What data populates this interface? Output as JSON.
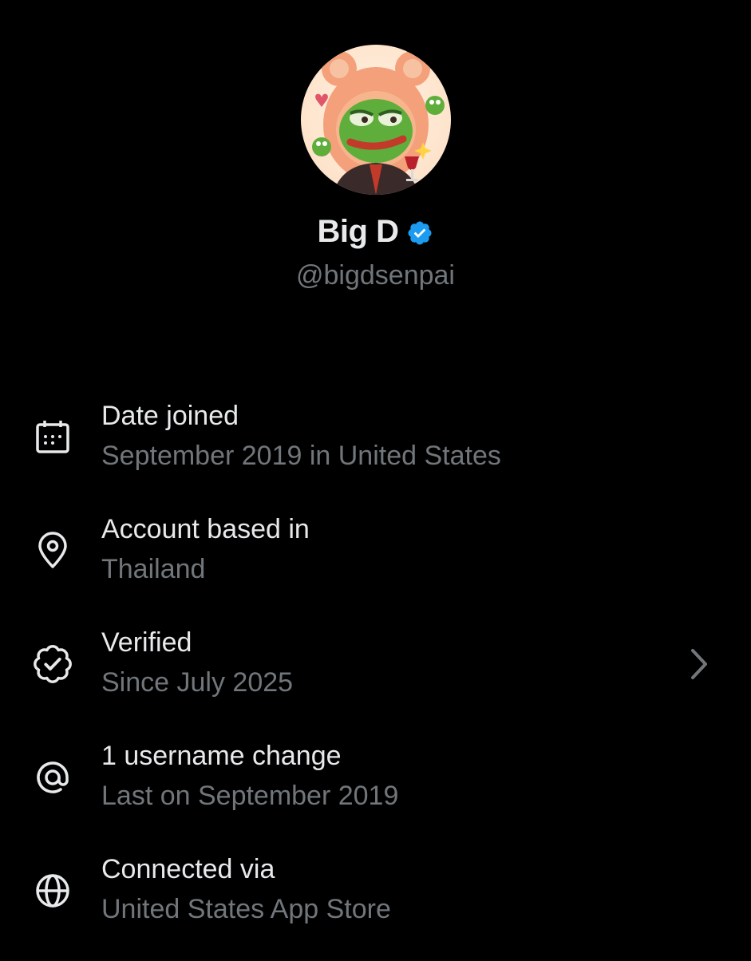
{
  "profile": {
    "display_name": "Big D",
    "handle": "@bigdsenpai",
    "avatar_icon": "cartoon-frog-avatar",
    "verified_badge_icon": "verified-check-badge-icon",
    "verified_color": "#1d9bf0"
  },
  "about": {
    "items": [
      {
        "icon": "calendar-icon",
        "title": "Date joined",
        "subtitle": "September 2019 in United States"
      },
      {
        "icon": "location-pin-icon",
        "title": "Account based in",
        "subtitle": "Thailand"
      },
      {
        "icon": "verified-badge-outline-icon",
        "title": "Verified",
        "subtitle": "Since July 2025",
        "has_chevron": true
      },
      {
        "icon": "at-sign-icon",
        "title": "1 username change",
        "subtitle": "Last on September 2019"
      },
      {
        "icon": "globe-icon",
        "title": "Connected via",
        "subtitle": "United States App Store"
      }
    ]
  },
  "colors": {
    "background": "#000000",
    "primary_text": "#e7e9ea",
    "secondary_text": "#71767b"
  }
}
